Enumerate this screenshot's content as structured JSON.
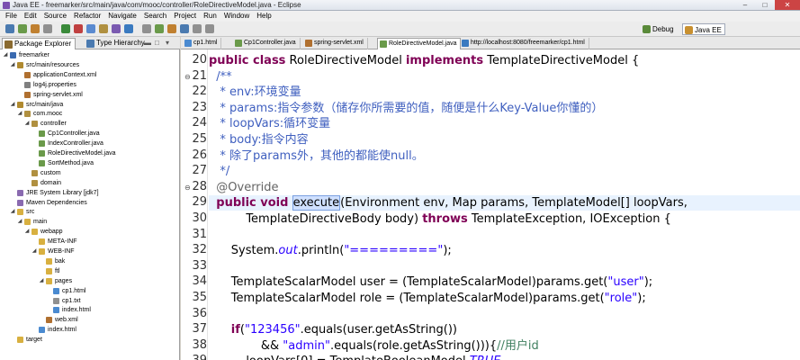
{
  "window": {
    "title": "Java EE - freemarker/src/main/java/com/mooc/controller/RoleDirectiveModel.java - Eclipse"
  },
  "menu": [
    "File",
    "Edit",
    "Source",
    "Refactor",
    "Navigate",
    "Search",
    "Project",
    "Run",
    "Window",
    "Help"
  ],
  "perspectives": [
    {
      "label": "Debug",
      "icon": "debug-icon",
      "color": "#5a8a3a"
    },
    {
      "label": "Java EE",
      "icon": "javaee-icon",
      "color": "#c89030"
    }
  ],
  "left_tabs": [
    {
      "label": "Package Explorer",
      "icon": "package-explorer-icon",
      "color": "#8a6a30",
      "active": true
    },
    {
      "label": "Type Hierarchy",
      "icon": "type-hierarchy-icon",
      "color": "#4a7ab0",
      "active": false
    }
  ],
  "editor_tabs": [
    {
      "label": "cp1.html",
      "icon": "html-file-icon",
      "color": "#4a8ad0"
    },
    {
      "label": "Cp1Controller.java",
      "icon": "java-file-icon",
      "color": "#6a9a4a"
    },
    {
      "label": "spring-servlet.xml",
      "icon": "xml-file-icon",
      "color": "#b07030"
    },
    {
      "label": "RoleDirectiveModel.java",
      "icon": "java-file-icon",
      "color": "#6a9a4a",
      "active": true
    },
    {
      "label": "http://localhost:8080/freemarker/cp1.html",
      "icon": "browser-icon",
      "color": "#3a7ac0"
    }
  ],
  "tree": [
    {
      "label": "freemarker",
      "depth": 0,
      "expanded": true,
      "icon": "project-icon",
      "color": "#3a6ab0"
    },
    {
      "label": "src/main/resources",
      "depth": 1,
      "expanded": true,
      "icon": "source-folder-icon",
      "color": "#b08a30"
    },
    {
      "label": "applicationContext.xml",
      "depth": 2,
      "icon": "xml-file-icon",
      "color": "#b07030"
    },
    {
      "label": "log4j.properties",
      "depth": 2,
      "icon": "properties-file-icon",
      "color": "#808080"
    },
    {
      "label": "spring-servlet.xml",
      "depth": 2,
      "icon": "xml-file-icon",
      "color": "#b07030"
    },
    {
      "label": "src/main/java",
      "depth": 1,
      "expanded": true,
      "icon": "source-folder-icon",
      "color": "#b08a30"
    },
    {
      "label": "com.mooc",
      "depth": 2,
      "expanded": true,
      "icon": "package-icon",
      "color": "#b09040"
    },
    {
      "label": "controller",
      "depth": 3,
      "expanded": true,
      "icon": "package-icon",
      "color": "#b09040"
    },
    {
      "label": "Cp1Controller.java",
      "depth": 4,
      "icon": "java-file-icon",
      "color": "#6a9a4a"
    },
    {
      "label": "IndexController.java",
      "depth": 4,
      "icon": "java-file-icon",
      "color": "#6a9a4a"
    },
    {
      "label": "RoleDirectiveModel.java",
      "depth": 4,
      "icon": "java-file-icon",
      "color": "#6a9a4a"
    },
    {
      "label": "SortMethod.java",
      "depth": 4,
      "icon": "java-file-icon",
      "color": "#6a9a4a"
    },
    {
      "label": "custom",
      "depth": 3,
      "icon": "package-icon",
      "color": "#b09040"
    },
    {
      "label": "domain",
      "depth": 3,
      "icon": "package-icon",
      "color": "#b09040"
    },
    {
      "label": "JRE System Library [jdk7]",
      "depth": 1,
      "icon": "library-icon",
      "color": "#8a6ab0"
    },
    {
      "label": "Maven Dependencies",
      "depth": 1,
      "icon": "library-icon",
      "color": "#8a6ab0"
    },
    {
      "label": "src",
      "depth": 1,
      "expanded": true,
      "icon": "folder-icon",
      "color": "#d8b040"
    },
    {
      "label": "main",
      "depth": 2,
      "expanded": true,
      "icon": "folder-icon",
      "color": "#d8b040"
    },
    {
      "label": "webapp",
      "depth": 3,
      "expanded": true,
      "icon": "folder-icon",
      "color": "#d8b040"
    },
    {
      "label": "META-INF",
      "depth": 4,
      "icon": "folder-icon",
      "color": "#d8b040"
    },
    {
      "label": "WEB-INF",
      "depth": 4,
      "expanded": true,
      "icon": "folder-icon",
      "color": "#d8b040"
    },
    {
      "label": "bak",
      "depth": 5,
      "icon": "folder-icon",
      "color": "#d8b040"
    },
    {
      "label": "ftl",
      "depth": 5,
      "icon": "folder-icon",
      "color": "#d8b040"
    },
    {
      "label": "pages",
      "depth": 5,
      "expanded": true,
      "icon": "folder-icon",
      "color": "#d8b040"
    },
    {
      "label": "cp1.html",
      "depth": 6,
      "icon": "html-file-icon",
      "color": "#4a8ad0"
    },
    {
      "label": "cp1.txt",
      "depth": 6,
      "icon": "text-file-icon",
      "color": "#909090"
    },
    {
      "label": "index.html",
      "depth": 6,
      "icon": "html-file-icon",
      "color": "#4a8ad0"
    },
    {
      "label": "web.xml",
      "depth": 5,
      "icon": "xml-file-icon",
      "color": "#b07030"
    },
    {
      "label": "index.html",
      "depth": 4,
      "icon": "html-file-icon",
      "color": "#4a8ad0"
    },
    {
      "label": "target",
      "depth": 1,
      "icon": "folder-icon",
      "color": "#d8b040"
    }
  ],
  "code": [
    {
      "num": "20",
      "html": "<span class='kw'>public class</span> RoleDirectiveModel <span class='kw'>implements</span> TemplateDirectiveModel {"
    },
    {
      "num": "21",
      "fold": true,
      "html": "<span class='cm'>  /**</span>"
    },
    {
      "num": "22",
      "html": "<span class='cm'>   * env:环境变量</span>"
    },
    {
      "num": "23",
      "html": "<span class='cm'>   * params:指令参数（储存你所需要的值，随便是什么Key-Value你懂的）</span>"
    },
    {
      "num": "24",
      "html": "<span class='cm'>   * loopVars:循环变量</span>"
    },
    {
      "num": "25",
      "html": "<span class='cm'>   * body:指令内容</span>"
    },
    {
      "num": "26",
      "html": "<span class='cm'>   * 除了params外，其他的都能使null。</span>"
    },
    {
      "num": "27",
      "html": "<span class='cm'>   */</span>"
    },
    {
      "num": "28",
      "fold": true,
      "html": "<span class='an'>  @Override</span>"
    },
    {
      "num": "29",
      "cur": true,
      "html": "  <span class='kw'>public void</span> <span class='sel'>execute</span>(Environment env, Map params, TemplateModel[] loopVars,"
    },
    {
      "num": "30",
      "html": "          TemplateDirectiveBody body) <span class='kw'>throws</span> TemplateException, IOException {"
    },
    {
      "num": "31",
      "html": ""
    },
    {
      "num": "32",
      "html": "      System.<span class='it st'>out</span>.println(<span class='st'>\"=========\"</span>);"
    },
    {
      "num": "33",
      "html": ""
    },
    {
      "num": "34",
      "html": "      TemplateScalarModel user = (TemplateScalarModel)params.get(<span class='st'>\"user\"</span>);"
    },
    {
      "num": "35",
      "html": "      TemplateScalarModel role = (TemplateScalarModel)params.get(<span class='st'>\"role\"</span>);"
    },
    {
      "num": "36",
      "html": ""
    },
    {
      "num": "37",
      "html": "      <span class='kw'>if</span>(<span class='st'>\"123456\"</span>.equals(user.getAsString())"
    },
    {
      "num": "38",
      "html": "              &amp;&amp; <span class='st'>\"admin\"</span>.equals(role.getAsString())){<span class='cm2'>//用户id</span>"
    },
    {
      "num": "39",
      "html": "          loopVars[0] = TemplateBooleanModel.<span class='it st'>TRUE</span>"
    }
  ]
}
